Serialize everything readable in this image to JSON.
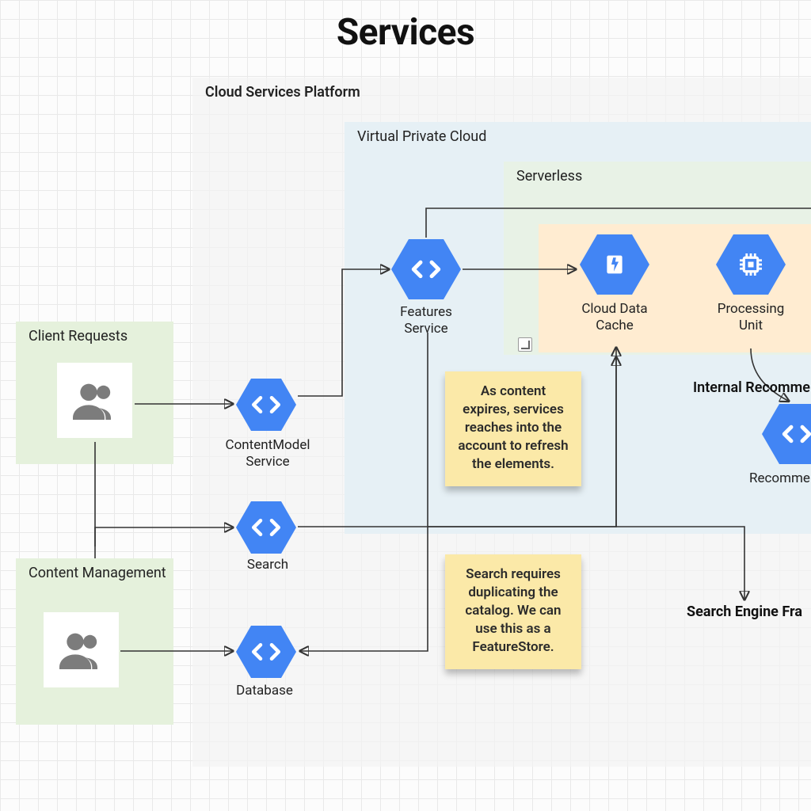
{
  "title": "Services",
  "regions": {
    "cloud": {
      "label": "Cloud Services Platform"
    },
    "vpc": {
      "label": "Virtual Private Cloud"
    },
    "serverless": {
      "label": "Serverless"
    }
  },
  "user_boxes": {
    "client": {
      "label": "Client Requests"
    },
    "content": {
      "label": "Content Management"
    }
  },
  "nodes": {
    "content_model": {
      "label": "ContentModel\nService"
    },
    "search": {
      "label": "Search"
    },
    "database": {
      "label": "Database"
    },
    "features": {
      "label": "Features\nService"
    },
    "cache": {
      "label": "Cloud Data\nCache"
    },
    "processing": {
      "label": "Processing\nUnit"
    },
    "recommend": {
      "label": "Recomme"
    }
  },
  "sections": {
    "internal_rec": {
      "label": "Internal Recommen"
    },
    "search_engine": {
      "label": "Search Engine Fra"
    }
  },
  "stickies": {
    "top": {
      "text": "As content expires, services reaches into the account to refresh the elements."
    },
    "bottom": {
      "text": "Search requires duplicating the catalog. We can use this as a FeatureStore."
    }
  },
  "colors": {
    "hex_blue": "#4285f4"
  }
}
